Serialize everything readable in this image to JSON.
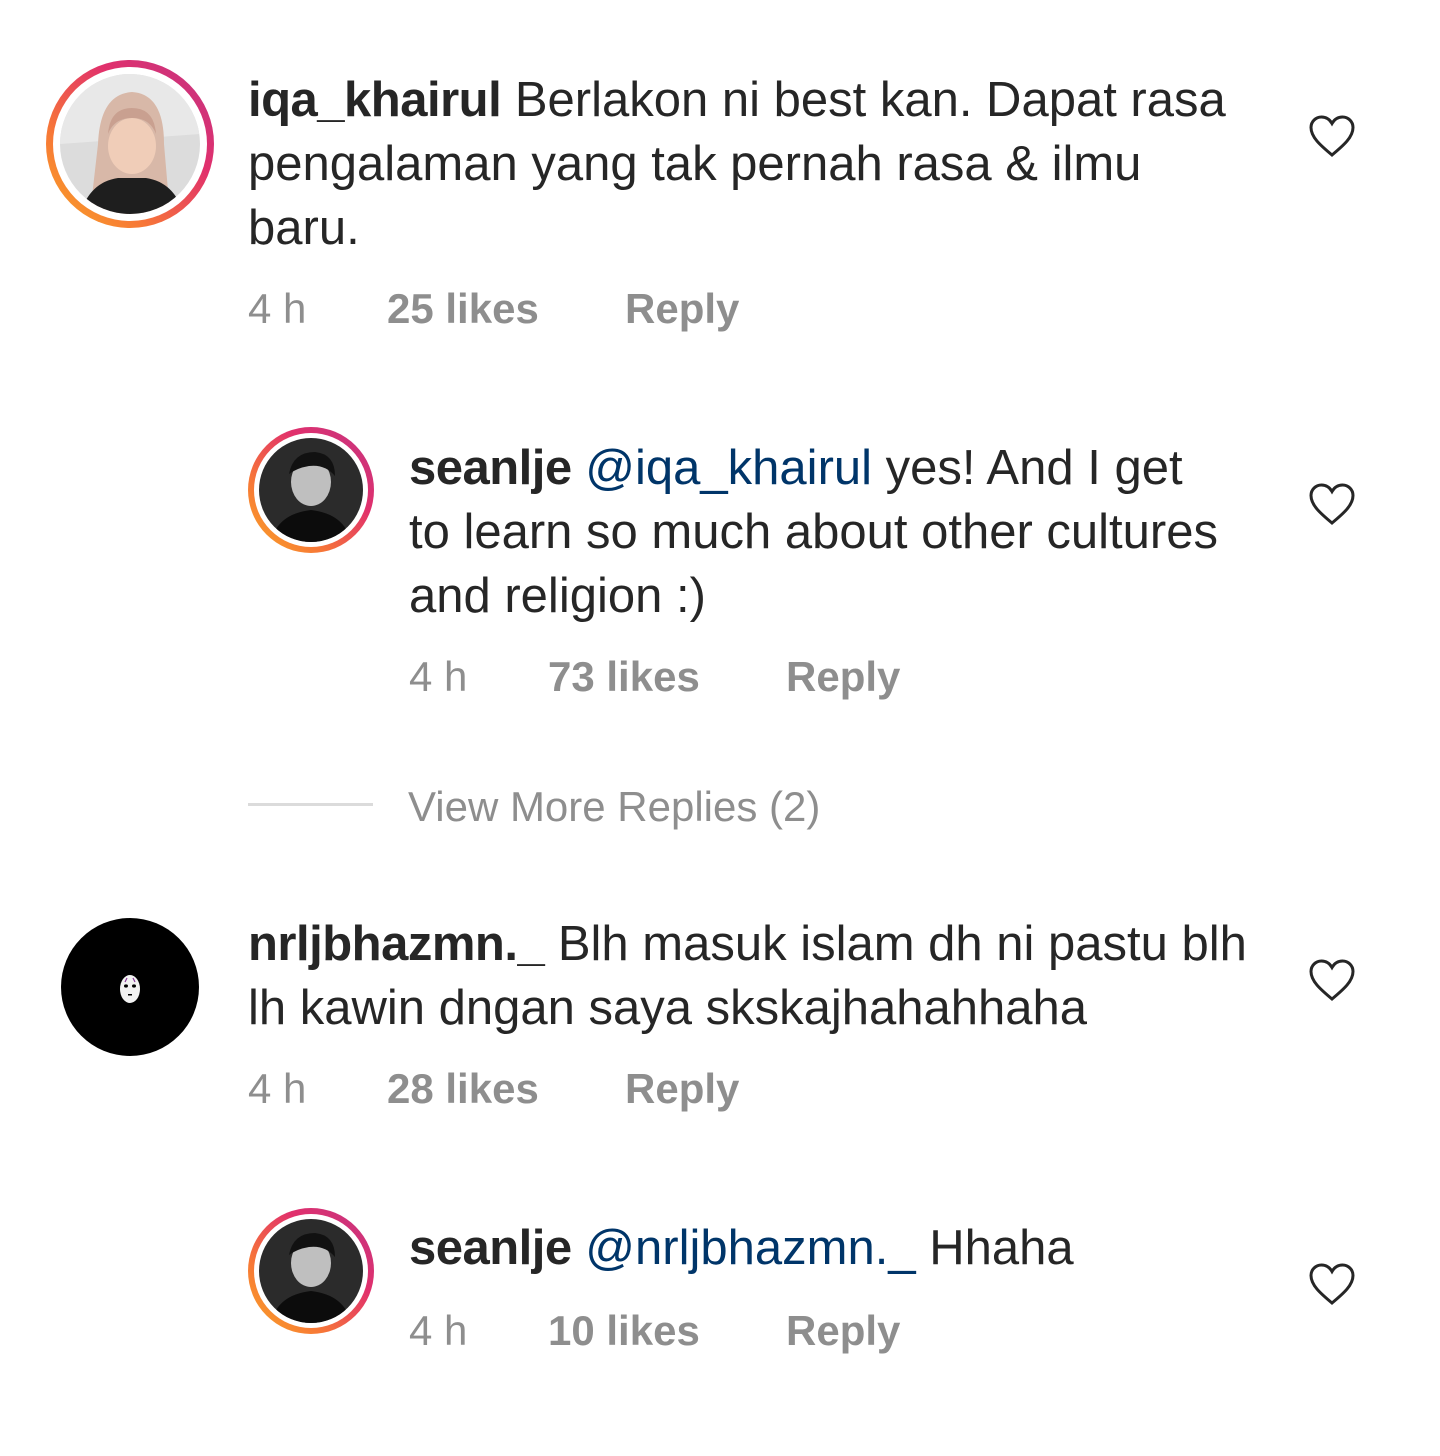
{
  "comments": [
    {
      "username": "iqa_khairul",
      "mention": "",
      "text": "Berlakon ni best kan. Dapat rasa pengalaman yang tak pernah rasa & ilmu baru.",
      "time": "4 h",
      "likes": "25 likes",
      "reply_label": "Reply",
      "avatar": "user-photo-hijab",
      "has_story_ring": true
    },
    {
      "username": "seanlje",
      "mention": "@iqa_khairul",
      "text": "yes! And I get to learn so much about other cultures and religion :)",
      "time": "4 h",
      "likes": "73 likes",
      "reply_label": "Reply",
      "avatar": "user-photo-bw-portrait",
      "has_story_ring": true
    },
    {
      "username": "nrljbhazmn._",
      "mention": "",
      "text": "Blh masuk islam dh ni pastu blh lh kawin dngan saya skskajhahahhaha",
      "time": "4 h",
      "likes": "28 likes",
      "reply_label": "Reply",
      "avatar": "no-face-mask-on-black",
      "has_story_ring": false
    },
    {
      "username": "seanlje",
      "mention": "@nrljbhazmn._",
      "text": "Hhaha",
      "time": "4 h",
      "likes": "10 likes",
      "reply_label": "Reply",
      "avatar": "user-photo-bw-portrait",
      "has_story_ring": true
    }
  ],
  "view_more_replies": "View More Replies (2)",
  "icons": {
    "like": "heart-outline-icon"
  },
  "colors": {
    "text": "#262626",
    "secondary": "#8e8e8e",
    "mention": "#003569",
    "ring_start": "#f9a825",
    "ring_end": "#c13584"
  }
}
